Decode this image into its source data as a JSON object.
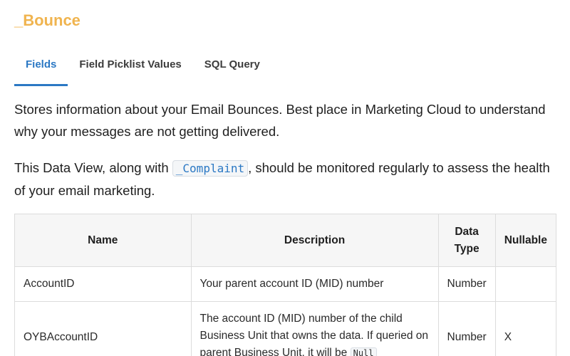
{
  "page": {
    "title": "_Bounce",
    "tabs": [
      {
        "label": "Fields",
        "active": true
      },
      {
        "label": "Field Picklist Values",
        "active": false
      },
      {
        "label": "SQL Query",
        "active": false
      }
    ],
    "description": "Stores information about your Email Bounces. Best place in Marketing Cloud to understand why your messages are not getting delivered.",
    "note_prefix": "This Data View, along with ",
    "note_code": "_Complaint",
    "note_suffix": ", should be monitored regularly to assess the health of your email marketing."
  },
  "table": {
    "headers": {
      "name": "Name",
      "description": "Description",
      "data_type": "Data Type",
      "nullable": "Nullable"
    },
    "rows": [
      {
        "name": "AccountID",
        "description": "Your parent account ID (MID) number",
        "data_type": "Number",
        "nullable": ""
      },
      {
        "name": "OYBAccountID",
        "description": "The account ID (MID) number of the child Business Unit that owns the data. If queried on parent Business Unit, it will be",
        "description_code": "Null",
        "data_type": "Number",
        "nullable": "X"
      }
    ]
  },
  "colors": {
    "title": "#f0b44f",
    "accent": "#2b78c4",
    "header_bg": "#f6f6f6"
  }
}
